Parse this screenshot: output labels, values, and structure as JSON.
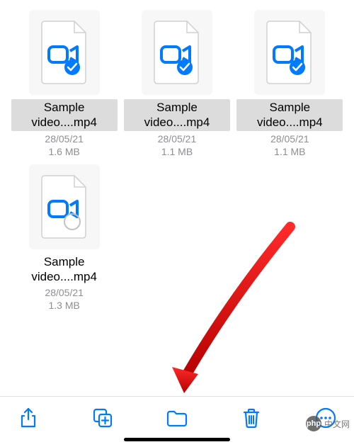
{
  "files": [
    {
      "name": "Sample video....mp4",
      "date": "28/05/21",
      "size": "1.6 MB",
      "selected": true
    },
    {
      "name": "Sample video....mp4",
      "date": "28/05/21",
      "size": "1.1 MB",
      "selected": true
    },
    {
      "name": "Sample video....mp4",
      "date": "28/05/21",
      "size": "1.1 MB",
      "selected": true
    },
    {
      "name": "Sample video....mp4",
      "date": "28/05/21",
      "size": "1.3 MB",
      "selected": false
    }
  ],
  "toolbar": {
    "share": "share-icon",
    "duplicate": "duplicate-icon",
    "move": "folder-icon",
    "delete": "trash-icon",
    "more": "more-icon"
  },
  "colors": {
    "accent": "#007aff",
    "muted": "#8e8e93",
    "highlight": "#dcdcdc"
  },
  "watermark": {
    "logo": "php",
    "text": "中文网"
  },
  "annotation": {
    "arrow_target": "folder-icon"
  }
}
